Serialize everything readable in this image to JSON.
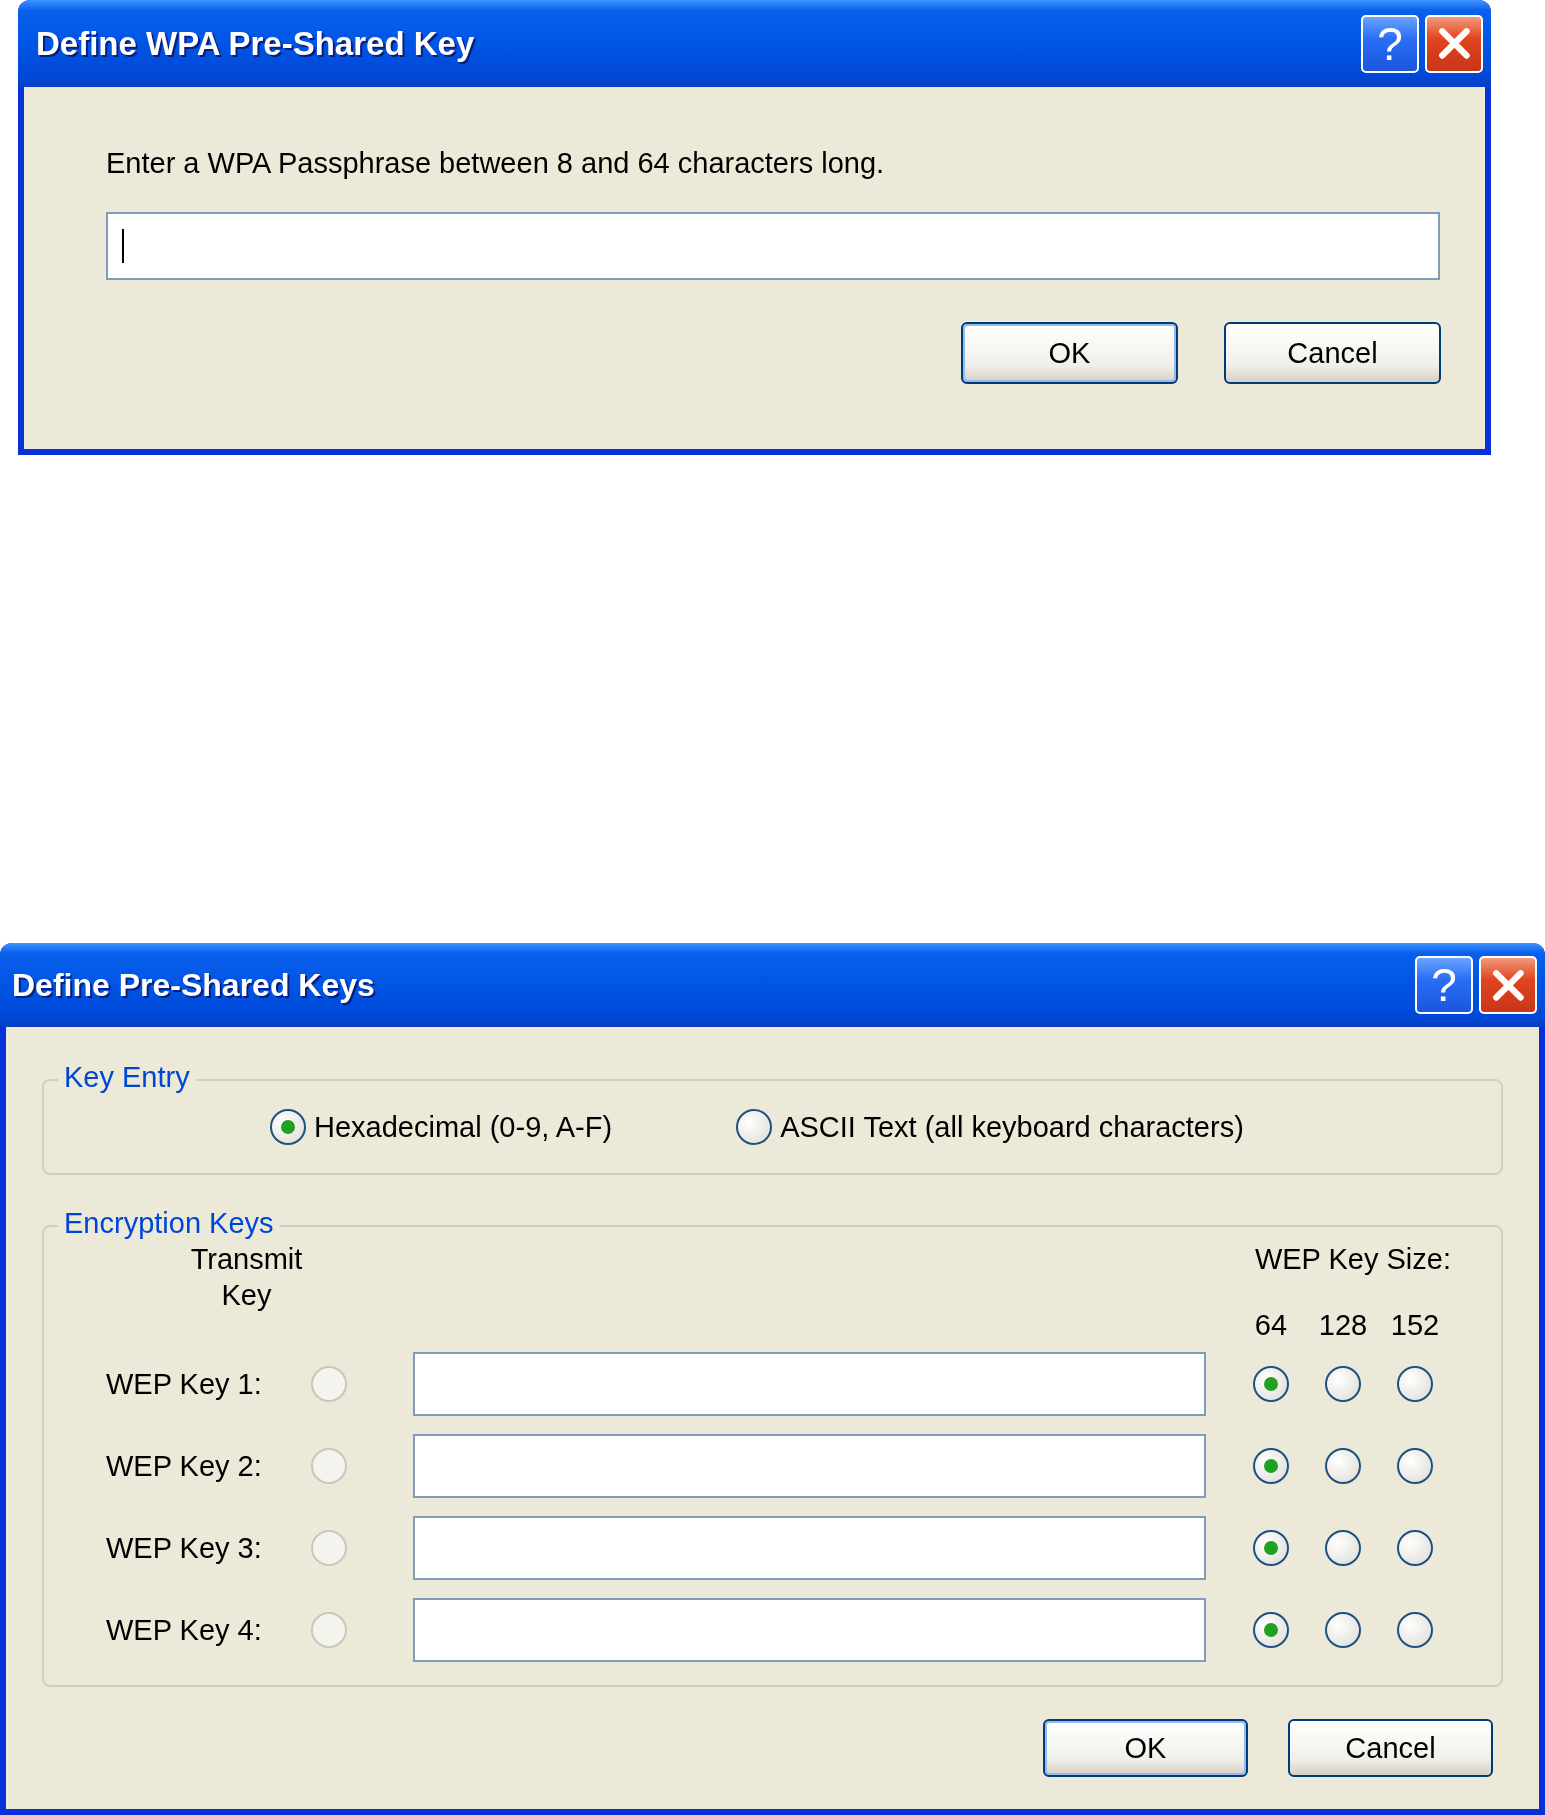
{
  "wpa_dialog": {
    "title": "Define WPA Pre-Shared Key",
    "help_button": "?",
    "prompt": "Enter a WPA Passphrase between 8 and 64 characters long.",
    "passphrase_field": {
      "focused": true
    },
    "buttons": [
      "OK",
      "Cancel"
    ]
  },
  "keys_dialog": {
    "title": "Define Pre-Shared Keys",
    "help_button": "?",
    "key_entry": {
      "legend": "Key Entry",
      "options": [
        {
          "label": "Hexadecimal (0-9, A-F)",
          "selected": true
        },
        {
          "label": "ASCII Text (all keyboard characters)",
          "selected": false
        }
      ]
    },
    "encryption_keys": {
      "legend": "Encryption Keys",
      "transmit_header": "Transmit Key",
      "size_header": "WEP Key Size:",
      "sizes": [
        "64",
        "128",
        "152"
      ],
      "keys": [
        {
          "label": "WEP Key 1:",
          "transmit": {
            "selected": false,
            "disabled": true
          },
          "size_options": [
            {
              "selected": true
            },
            {
              "selected": false
            },
            {
              "selected": false
            }
          ]
        },
        {
          "label": "WEP Key 2:",
          "transmit": {
            "selected": false,
            "disabled": true
          },
          "size_options": [
            {
              "selected": true
            },
            {
              "selected": false
            },
            {
              "selected": false
            }
          ]
        },
        {
          "label": "WEP Key 3:",
          "transmit": {
            "selected": false,
            "disabled": true
          },
          "size_options": [
            {
              "selected": true
            },
            {
              "selected": false
            },
            {
              "selected": false
            }
          ]
        },
        {
          "label": "WEP Key 4:",
          "transmit": {
            "selected": false,
            "disabled": true
          },
          "size_options": [
            {
              "selected": true
            },
            {
              "selected": false
            },
            {
              "selected": false
            }
          ]
        }
      ]
    },
    "buttons": [
      "OK",
      "Cancel"
    ]
  }
}
